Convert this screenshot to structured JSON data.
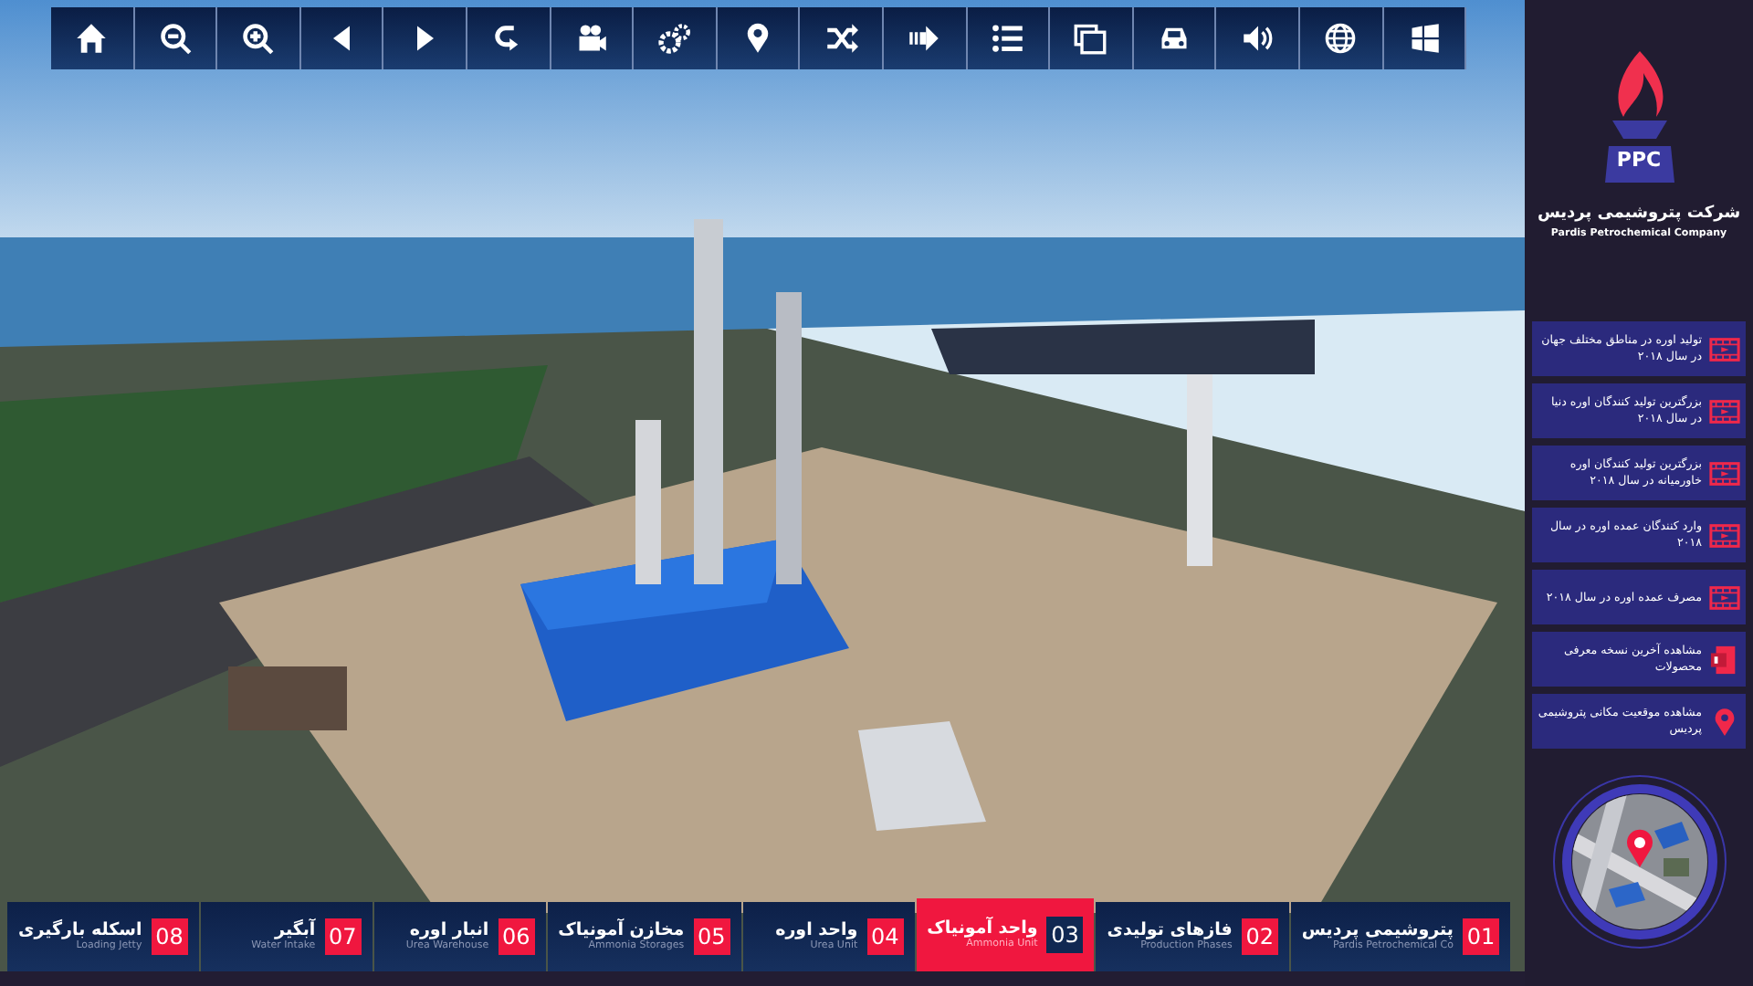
{
  "toolbar": [
    {
      "kind": "home"
    },
    {
      "kind": "zoom-out"
    },
    {
      "kind": "zoom-in"
    },
    {
      "kind": "prev"
    },
    {
      "kind": "next"
    },
    {
      "kind": "return"
    },
    {
      "kind": "camera"
    },
    {
      "kind": "gears"
    },
    {
      "kind": "pin"
    },
    {
      "kind": "shuffle"
    },
    {
      "kind": "forward"
    },
    {
      "kind": "list"
    },
    {
      "kind": "photos"
    },
    {
      "kind": "car"
    },
    {
      "kind": "volume"
    },
    {
      "kind": "globe"
    },
    {
      "kind": "panes"
    }
  ],
  "logo": {
    "mark": "PPC",
    "name": "شرکت پتروشیمی پردیس",
    "name_en": "Pardis Petrochemical Company"
  },
  "sidebar": {
    "items": [
      {
        "kind": "video",
        "text": "تولید اوره در مناطق مختلف جهان در سال ۲۰۱۸"
      },
      {
        "kind": "video",
        "text": "بزرگترین تولید کنندگان اوره دنیا در سال ۲۰۱۸"
      },
      {
        "kind": "video",
        "text": "بزرگترین تولید کنندگان اوره خاورمیانه در سال ۲۰۱۸"
      },
      {
        "kind": "video",
        "text": "وارد کنندگان عمده اوره در سال ۲۰۱۸"
      },
      {
        "kind": "video",
        "text": "مصرف عمده اوره در سال ۲۰۱۸"
      },
      {
        "kind": "document",
        "text": "مشاهده آخرین نسخه معرفی محصولات"
      },
      {
        "kind": "pin",
        "text": "مشاهده موقعیت مکانی پتروشیمی پردیس"
      }
    ]
  },
  "units": [
    {
      "number": "01",
      "title": "پتروشیمی پردیس",
      "subtitle": "Pardis Petrochemical Co",
      "selected": false
    },
    {
      "number": "02",
      "title": "فازهای تولیدی",
      "subtitle": "Production Phases",
      "selected": false
    },
    {
      "number": "03",
      "title": "واحد آمونیاک",
      "subtitle": "Ammonia Unit",
      "selected": true
    },
    {
      "number": "04",
      "title": "واحد اوره",
      "subtitle": "Urea Unit",
      "selected": false
    },
    {
      "number": "05",
      "title": "مخازن آمونیاک",
      "subtitle": "Ammonia Storages",
      "selected": false
    },
    {
      "number": "06",
      "title": "انبار اوره",
      "subtitle": "Urea Warehouse",
      "selected": false
    },
    {
      "number": "07",
      "title": "آبگیر",
      "subtitle": "Water Intake",
      "selected": false
    },
    {
      "number": "08",
      "title": "اسکله بارگیری",
      "subtitle": "Loading Jetty",
      "selected": false
    }
  ]
}
